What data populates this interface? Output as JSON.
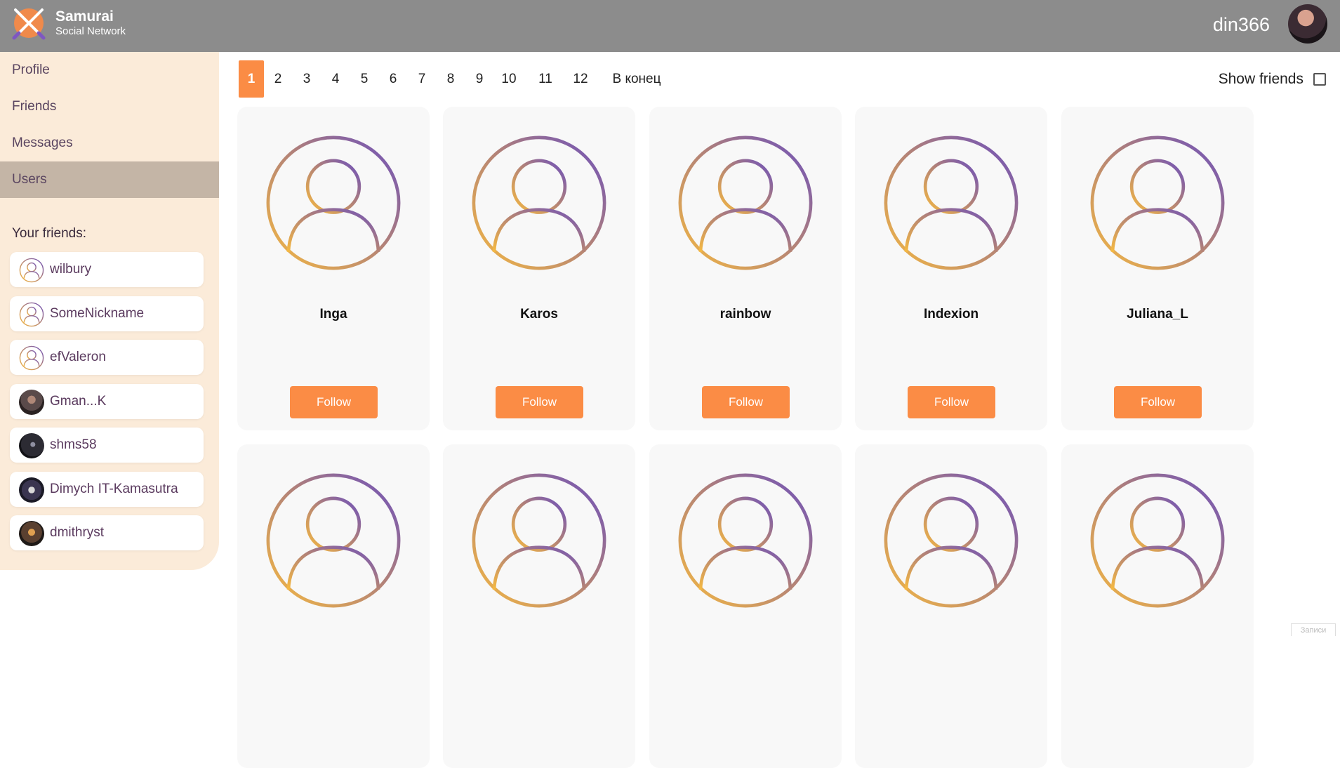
{
  "header": {
    "brand_title": "Samurai",
    "brand_subtitle": "Social Network",
    "username": "din366",
    "logo_icon": "crossed-swords-icon"
  },
  "sidebar": {
    "nav": [
      {
        "label": "Profile",
        "active": false
      },
      {
        "label": "Friends",
        "active": false
      },
      {
        "label": "Messages",
        "active": false
      },
      {
        "label": "Users",
        "active": true
      }
    ],
    "friends_title": "Your friends:",
    "friends": [
      {
        "name": "wilbury",
        "avatar": "default-user-icon"
      },
      {
        "name": "SomeNickname",
        "avatar": "default-user-icon"
      },
      {
        "name": "efValeron",
        "avatar": "default-user-icon"
      },
      {
        "name": "Gman...K",
        "avatar": "photo"
      },
      {
        "name": "shms58",
        "avatar": "photo"
      },
      {
        "name": "Dimych IT-Kamasutra",
        "avatar": "photo"
      },
      {
        "name": "dmithryst",
        "avatar": "photo"
      }
    ]
  },
  "pagination": {
    "pages": [
      "1",
      "2",
      "3",
      "4",
      "5",
      "6",
      "7",
      "8",
      "9",
      "10",
      "11",
      "12",
      "В конец"
    ],
    "current": "1"
  },
  "filter": {
    "show_friends_label": "Show friends",
    "checked": false
  },
  "users": [
    {
      "name": "Inga",
      "button": "Follow"
    },
    {
      "name": "Karos",
      "button": "Follow"
    },
    {
      "name": "rainbow",
      "button": "Follow"
    },
    {
      "name": "Indexion",
      "button": "Follow"
    },
    {
      "name": "Juliana_L",
      "button": "Follow"
    },
    {
      "name": "",
      "button": ""
    },
    {
      "name": "",
      "button": ""
    },
    {
      "name": "",
      "button": ""
    },
    {
      "name": "",
      "button": ""
    },
    {
      "name": "",
      "button": ""
    }
  ],
  "corner_label": "Записи",
  "colors": {
    "header": "#8c8c8c",
    "sidebar": "#fbebd9",
    "nav_active": "#c4b5a6",
    "accent": "#fb8c45",
    "gradient_start": "#f5b942",
    "gradient_end": "#6a4fbf"
  }
}
